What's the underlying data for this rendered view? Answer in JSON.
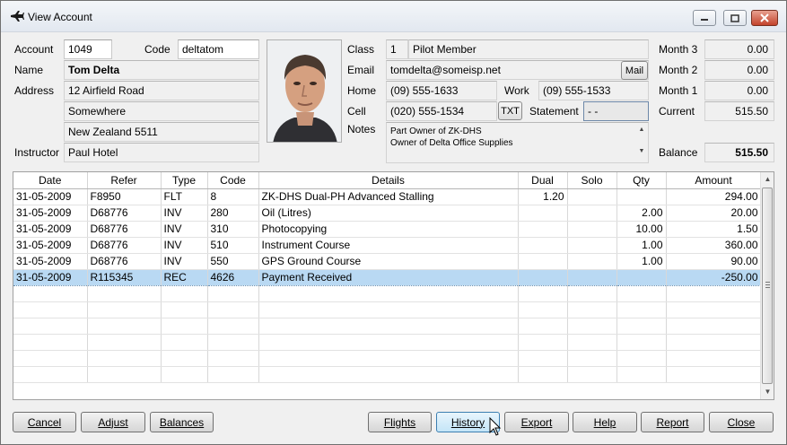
{
  "window": {
    "title": "View Account",
    "icon": "aircraft-icon",
    "controls": [
      "minimize-icon",
      "maximize-icon",
      "close-icon"
    ]
  },
  "account": {
    "account_label": "Account",
    "account_value": "1049",
    "code_label": "Code",
    "code_value": "deltatom",
    "name_label": "Name",
    "name_value": "Tom Delta",
    "address_label": "Address",
    "address_lines": [
      "12 Airfield Road",
      "Somewhere",
      "New Zealand 5511"
    ],
    "instructor_label": "Instructor",
    "instructor_value": "Paul Hotel"
  },
  "contact": {
    "class_label": "Class",
    "class_num": "1",
    "class_name": "Pilot Member",
    "email_label": "Email",
    "email_value": "tomdelta@someisp.net",
    "mail_button": "Mail",
    "home_label": "Home",
    "home_value": "(09) 555-1633",
    "work_label": "Work",
    "work_value": "(09) 555-1533",
    "cell_label": "Cell",
    "cell_value": "(020) 555-1534",
    "txt_button": "TXT",
    "statement_label": "Statement",
    "statement_value": "- -",
    "notes_label": "Notes",
    "notes_lines": [
      "Part Owner of ZK-DHS",
      "Owner of Delta Office Supplies"
    ]
  },
  "balances": {
    "month3_label": "Month 3",
    "month3_value": "0.00",
    "month2_label": "Month 2",
    "month2_value": "0.00",
    "month1_label": "Month 1",
    "month1_value": "0.00",
    "current_label": "Current",
    "current_value": "515.50",
    "balance_label": "Balance",
    "balance_value": "515.50"
  },
  "table": {
    "columns": [
      "Date",
      "Refer",
      "Type",
      "Code",
      "Details",
      "Dual",
      "Solo",
      "Qty",
      "Amount"
    ],
    "rows": [
      [
        "31-05-2009",
        "F8950",
        "FLT",
        "8",
        "ZK-DHS Dual-PH  Advanced Stalling",
        "1.20",
        "",
        "",
        "294.00"
      ],
      [
        "31-05-2009",
        "D68776",
        "INV",
        "280",
        "Oil (Litres)",
        "",
        "",
        "2.00",
        "20.00"
      ],
      [
        "31-05-2009",
        "D68776",
        "INV",
        "310",
        "Photocopying",
        "",
        "",
        "10.00",
        "1.50"
      ],
      [
        "31-05-2009",
        "D68776",
        "INV",
        "510",
        "Instrument Course",
        "",
        "",
        "1.00",
        "360.00"
      ],
      [
        "31-05-2009",
        "D68776",
        "INV",
        "550",
        "GPS Ground Course",
        "",
        "",
        "1.00",
        "90.00"
      ],
      [
        "31-05-2009",
        "R115345",
        "REC",
        "4626",
        "Payment Received",
        "",
        "",
        "",
        "-250.00"
      ]
    ],
    "selected_row": 5
  },
  "buttons": {
    "cancel": "Cancel",
    "adjust": "Adjust",
    "balances": "Balances",
    "flights": "Flights",
    "history": "History",
    "export": "Export",
    "help": "Help",
    "report": "Report",
    "close": "Close"
  }
}
